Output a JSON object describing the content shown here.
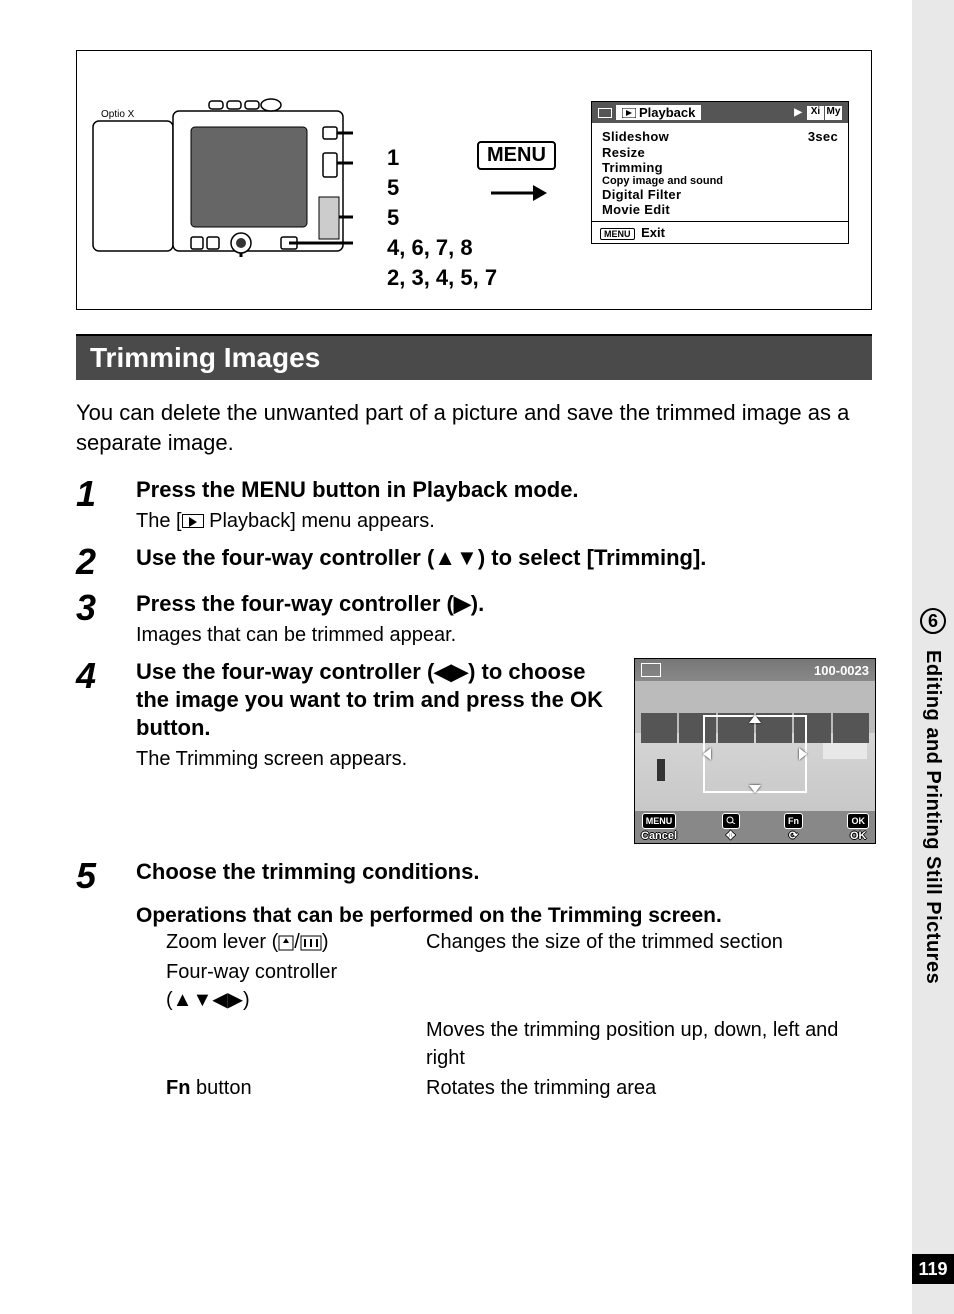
{
  "sidebar": {
    "chapter_num": "6",
    "chapter_title": "Editing and Printing Still Pictures",
    "page_num": "119"
  },
  "diagram": {
    "callout1": "1",
    "callout2": "5",
    "callout3": "5",
    "callout4": "4, 6, 7, 8",
    "callout5": "2, 3, 4, 5, 7",
    "menu_label": "MENU"
  },
  "playback_menu": {
    "tab_label": "Playback",
    "right_tab_my": "My",
    "items": {
      "slideshow": "Slideshow",
      "slideshow_val": "3sec",
      "resize": "Resize",
      "trimming": "Trimming",
      "copy": "Copy image and sound",
      "filter": "Digital Filter",
      "movie": "Movie Edit"
    },
    "footer_menu": "MENU",
    "footer_exit": "Exit"
  },
  "section_title": "Trimming Images",
  "intro": "You can delete the unwanted part of a picture and save the trimmed image as a separate image.",
  "steps": {
    "s1": {
      "n": "1",
      "h1": "Press the ",
      "h_menu": "MENU",
      "h2": " button in Playback mode.",
      "sub_a": "The [",
      "sub_b": " Playback] menu appears."
    },
    "s2": {
      "n": "2",
      "h": "Use the four-way controller (▲▼) to select [Trimming]."
    },
    "s3": {
      "n": "3",
      "h": "Press the four-way controller (▶).",
      "sub": "Images that can be trimmed appear."
    },
    "s4": {
      "n": "4",
      "h1": "Use the four-way controller (◀▶) to choose the image you want to trim and press the ",
      "h_ok": "OK",
      "h2": " button.",
      "sub": "The Trimming screen appears."
    },
    "s5": {
      "n": "5",
      "h": "Choose the trimming conditions."
    }
  },
  "trim_screen": {
    "file_num": "100-0023",
    "menu_tag": "MENU",
    "cancel": "Cancel",
    "fn_tag": "Fn",
    "ok_tag": "OK",
    "ok_text": "OK"
  },
  "ops": {
    "heading": "Operations that can be performed on the Trimming screen.",
    "zoom_label_a": "Zoom lever (",
    "zoom_label_b": ")",
    "zoom_desc": "Changes the size of the trimmed section",
    "four_label": "Four-way controller (▲▼◀▶)",
    "four_desc": "Moves the trimming position up, down, left and right",
    "fn_label_a": "Fn",
    "fn_label_b": " button",
    "fn_desc": "Rotates the trimming area"
  }
}
